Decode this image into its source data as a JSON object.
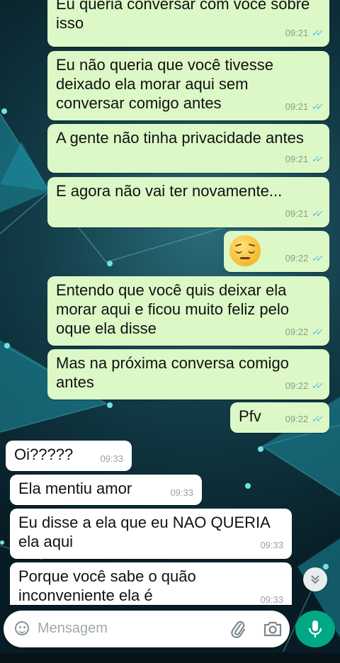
{
  "messages": [
    {
      "text": "Eu queria conversar com você sobre\nisso",
      "time": "09:21",
      "dir": "out"
    },
    {
      "text": "Eu não queria que você tivesse\ndeixado ela morar aqui sem\nconversar comigo antes",
      "time": "09:21",
      "dir": "out"
    },
    {
      "text": "A gente não tinha privacidade antes",
      "time": "09:21",
      "dir": "out"
    },
    {
      "text": "E agora não vai ter novamente...",
      "time": "09:21",
      "dir": "out"
    },
    {
      "text": "",
      "emoji": "pensive-face",
      "time": "09:22",
      "dir": "out"
    },
    {
      "text": "Entendo que você quis deixar ela\nmorar aqui e ficou muito feliz pelo\noque ela disse",
      "time": "09:22",
      "dir": "out"
    },
    {
      "text": "Mas na próxima conversa comigo\nantes",
      "time": "09:22",
      "dir": "out"
    },
    {
      "text": "Pfv",
      "time": "09:22",
      "dir": "out"
    },
    {
      "text": "Oi?????",
      "time": "09:33",
      "dir": "in"
    },
    {
      "text": "Ela mentiu amor",
      "time": "09:33",
      "dir": "in"
    },
    {
      "text": "Eu disse a ela que eu NAO QUERIA\nela aqui",
      "time": "09:33",
      "dir": "in"
    },
    {
      "text": "Porque você sabe o quão\ninconveniente ela é",
      "time": "09:33",
      "dir": "in"
    }
  ],
  "composer": {
    "placeholder": "Mensagem",
    "icons": [
      "emoji-icon",
      "attach-icon",
      "camera-icon",
      "mic-icon"
    ]
  },
  "colors": {
    "outgoing_bubble": "#dcf8c6",
    "incoming_bubble": "#ffffff",
    "read_ticks": "#4fb6ec",
    "mic_button": "#00a884"
  }
}
